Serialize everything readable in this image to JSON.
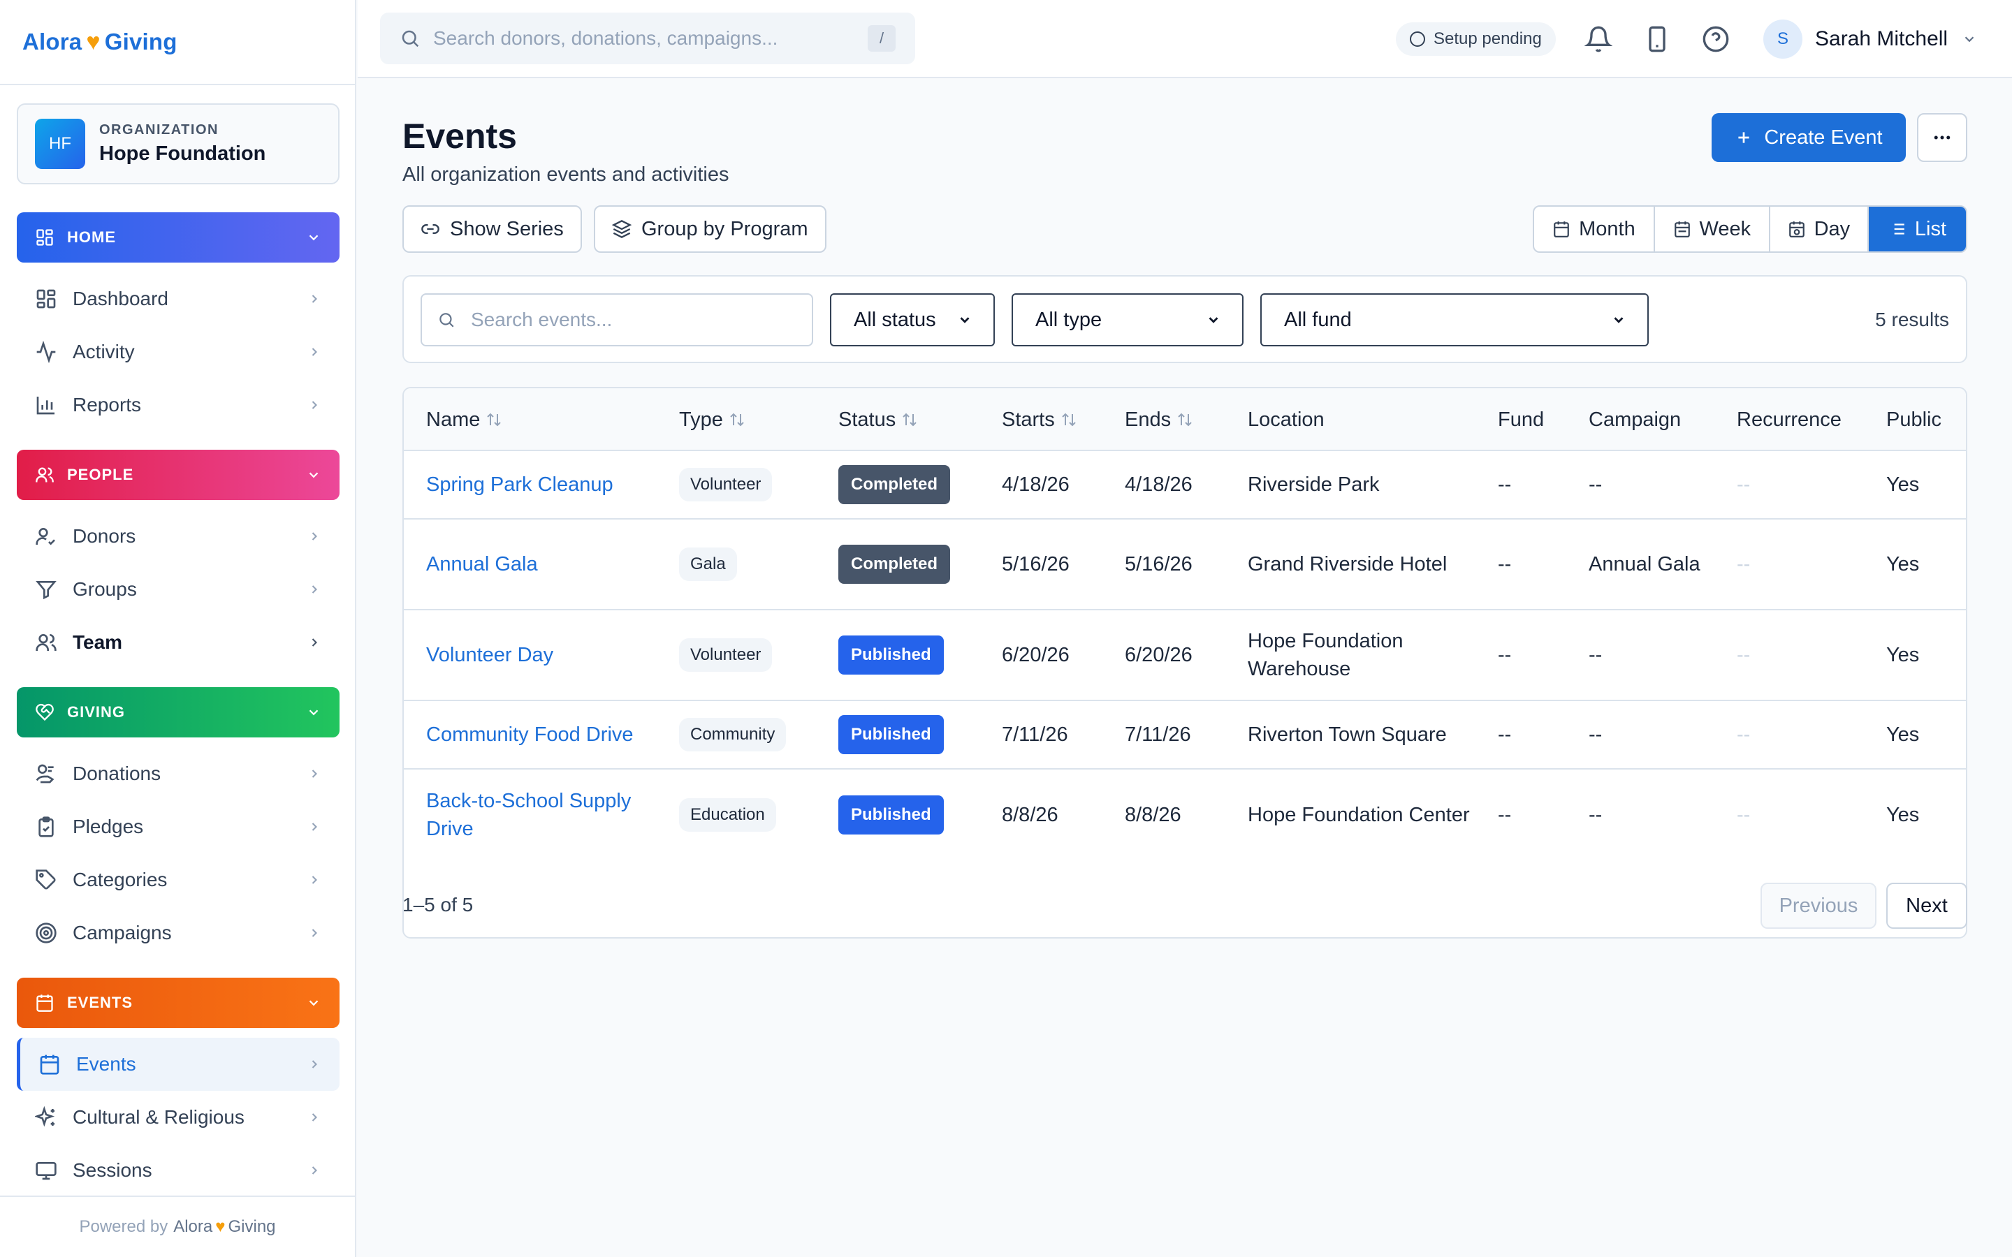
{
  "brand": {
    "name_left": "Alora",
    "name_right": "Giving",
    "heart": "♥"
  },
  "org": {
    "initials": "HF",
    "label": "ORGANIZATION",
    "name": "Hope Foundation"
  },
  "sidebar": {
    "home": {
      "label": "HOME",
      "items": [
        {
          "label": "Dashboard",
          "icon": "dashboard-icon"
        },
        {
          "label": "Activity",
          "icon": "activity-icon"
        },
        {
          "label": "Reports",
          "icon": "reports-icon"
        }
      ]
    },
    "people": {
      "label": "PEOPLE",
      "items": [
        {
          "label": "Donors",
          "icon": "donor-icon"
        },
        {
          "label": "Groups",
          "icon": "filter-icon"
        },
        {
          "label": "Team",
          "icon": "team-icon"
        }
      ]
    },
    "giving": {
      "label": "GIVING",
      "items": [
        {
          "label": "Donations",
          "icon": "donation-icon"
        },
        {
          "label": "Pledges",
          "icon": "clipboard-icon"
        },
        {
          "label": "Categories",
          "icon": "tag-icon"
        },
        {
          "label": "Campaigns",
          "icon": "target-icon"
        }
      ]
    },
    "events": {
      "label": "EVENTS",
      "items": [
        {
          "label": "Events",
          "icon": "calendar-icon"
        },
        {
          "label": "Cultural & Religious",
          "icon": "sparkles-icon"
        },
        {
          "label": "Sessions",
          "icon": "monitor-icon"
        }
      ]
    },
    "powered_by": "Powered by",
    "powered_brand_left": "Alora",
    "powered_brand_right": "Giving"
  },
  "topbar": {
    "search_placeholder": "Search donors, donations, campaigns...",
    "search_shortcut": "/",
    "setup_status": "Setup pending",
    "user_initial": "S",
    "user_name": "Sarah Mitchell"
  },
  "page": {
    "title": "Events",
    "subtitle": "All organization events and activities",
    "create_label": "Create Event",
    "show_series_label": "Show Series",
    "group_by_label": "Group by Program",
    "views": [
      "Month",
      "Week",
      "Day",
      "List"
    ],
    "active_view": "List"
  },
  "filters": {
    "search_placeholder": "Search events...",
    "status": "All status",
    "type": "All type",
    "fund": "All fund",
    "results": "5 results"
  },
  "table": {
    "columns": [
      "Name",
      "Type",
      "Status",
      "Starts",
      "Ends",
      "Location",
      "Fund",
      "Campaign",
      "Recurrence",
      "Public"
    ],
    "rows": [
      {
        "name": "Spring Park Cleanup",
        "type": "Volunteer",
        "status": "Completed",
        "starts": "4/18/26",
        "ends": "4/18/26",
        "location": "Riverside Park",
        "fund": "--",
        "campaign": "--",
        "recurrence": "--",
        "public": "Yes"
      },
      {
        "name": "Annual Gala",
        "type": "Gala",
        "status": "Completed",
        "starts": "5/16/26",
        "ends": "5/16/26",
        "location": "Grand Riverside Hotel",
        "fund": "--",
        "campaign": "Annual Gala",
        "recurrence": "--",
        "public": "Yes"
      },
      {
        "name": "Volunteer Day",
        "type": "Volunteer",
        "status": "Published",
        "starts": "6/20/26",
        "ends": "6/20/26",
        "location": "Hope Foundation Warehouse",
        "fund": "--",
        "campaign": "--",
        "recurrence": "--",
        "public": "Yes"
      },
      {
        "name": "Community Food Drive",
        "type": "Community",
        "status": "Published",
        "starts": "7/11/26",
        "ends": "7/11/26",
        "location": "Riverton Town Square",
        "fund": "--",
        "campaign": "--",
        "recurrence": "--",
        "public": "Yes"
      },
      {
        "name": "Back-to-School Supply Drive",
        "type": "Education",
        "status": "Published",
        "starts": "8/8/26",
        "ends": "8/8/26",
        "location": "Hope Foundation Center",
        "fund": "--",
        "campaign": "--",
        "recurrence": "--",
        "public": "Yes"
      }
    ]
  },
  "pager": {
    "range": "1–5 of 5",
    "previous": "Previous",
    "next": "Next"
  },
  "colors": {
    "primary": "#1d6fd8",
    "completed": "#475569",
    "published": "#2563eb",
    "accent_heart": "#f59e0b"
  }
}
